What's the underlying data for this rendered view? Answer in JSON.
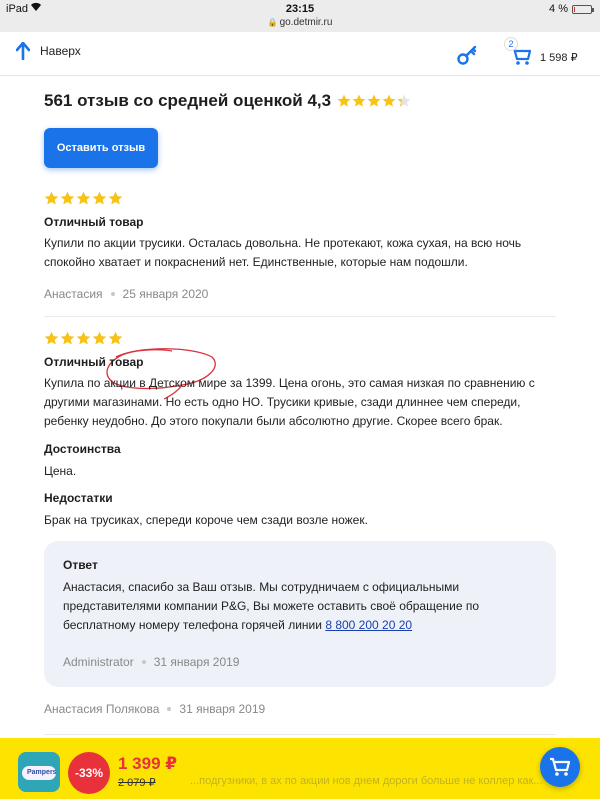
{
  "status_bar": {
    "device": "iPad",
    "time": "23:15",
    "url": "go.detmir.ru",
    "battery": "4 %"
  },
  "nav": {
    "back_label": "Наверх",
    "cart_count": "2",
    "cart_total": "1 598 ₽"
  },
  "summary": {
    "text": "561 отзыв со средней оценкой 4,3",
    "rating": 4.3
  },
  "leave_review_label": "Оставить отзыв",
  "reviews": [
    {
      "rating": 5,
      "title": "Отличный товар",
      "text": "Купили по акции трусики. Осталась довольна. Не протекают, кожа сухая, на всю ночь спокойно хватает и покраснений нет. Единственные, которые нам подошли.",
      "author": "Анастасия",
      "date": "25 января 2020"
    },
    {
      "rating": 5,
      "title": "Отличный товар",
      "text": "Купила по акции в Детском мире за 1399. Цена огонь, это самая низкая по сравнению с другими магазинами. Но есть одно НО. Трусики кривые, сзади длиннее чем спереди, ребенку неудобно. До этого покупали были абсолютно другие. Скорее всего брак.",
      "pros_title": "Достоинства",
      "pros": "Цена.",
      "cons_title": "Недостатки",
      "cons": "Брак на трусиках, спереди короче чем сзади возле ножек.",
      "answer": {
        "title": "Ответ",
        "text": "Анастасия, спасибо за Ваш отзыв. Мы сотрудничаем с официальными представителями компании P&G, Вы можете оставить своё обращение по бесплатному номеру телефона горячей линии",
        "phone": "8 800 200 20 20",
        "author": "Administrator",
        "date": "31 января 2019"
      },
      "author": "Анастасия Полякова",
      "date": "31 января 2019"
    }
  ],
  "bottom_bar": {
    "discount": "-33%",
    "price_new": "1 399 ₽",
    "price_old": "2 079 ₽",
    "behind_text": "...подгузники, в ах по акции нов днем дороги больше не коллер как..."
  },
  "colors": {
    "accent": "#1a73e8",
    "star": "#f7c317",
    "price": "#e8313a",
    "bottom_bar": "#fde400"
  }
}
